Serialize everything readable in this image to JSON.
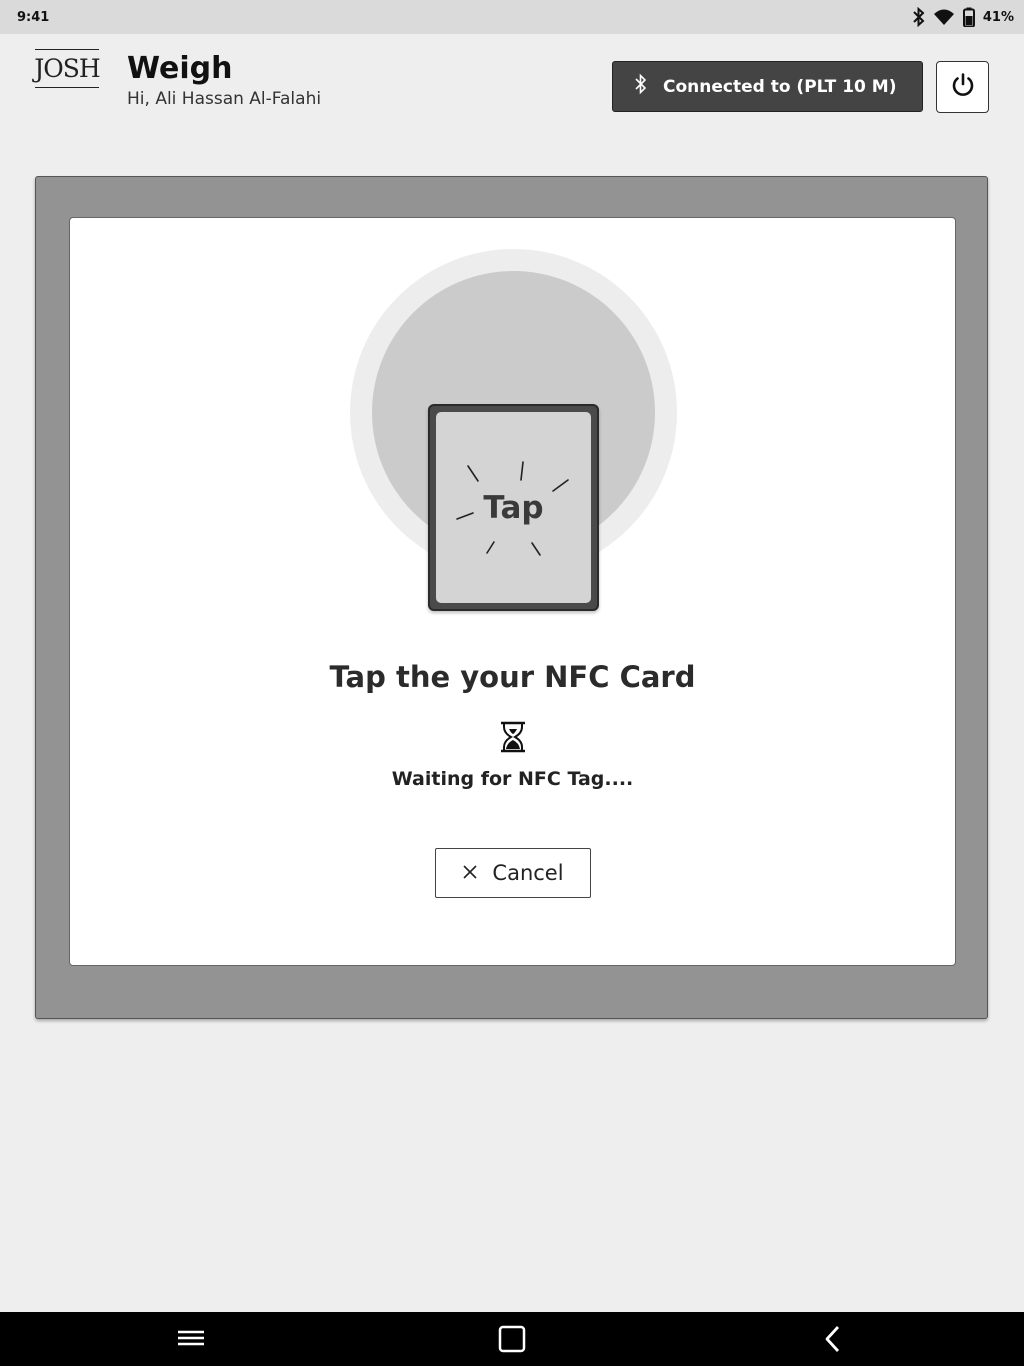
{
  "status_bar": {
    "time": "9:41",
    "battery": "41%",
    "icons": [
      "bluetooth-icon",
      "wifi-icon",
      "battery-icon"
    ]
  },
  "header": {
    "logo_text": "JOSH",
    "title": "Weigh",
    "greeting": "Hi, Ali Hassan Al-Falahi",
    "connection_label": "Connected to (PLT 10 M)",
    "connection_icon": "bluetooth-icon",
    "power_icon": "power-icon"
  },
  "nfc_prompt": {
    "card_label": "Tap",
    "title": "Tap the your NFC Card",
    "status_icon": "hourglass-icon",
    "status_text": "Waiting for NFC Tag....",
    "cancel_label": "Cancel",
    "cancel_icon": "close-icon"
  },
  "nav_bar": {
    "buttons": [
      "menu-icon",
      "home-icon",
      "back-icon"
    ]
  },
  "colors": {
    "background": "#eeeeee",
    "status_bar": "#dadada",
    "panel": "#939393",
    "connection_button": "#444444",
    "nav_bar": "#000000"
  }
}
